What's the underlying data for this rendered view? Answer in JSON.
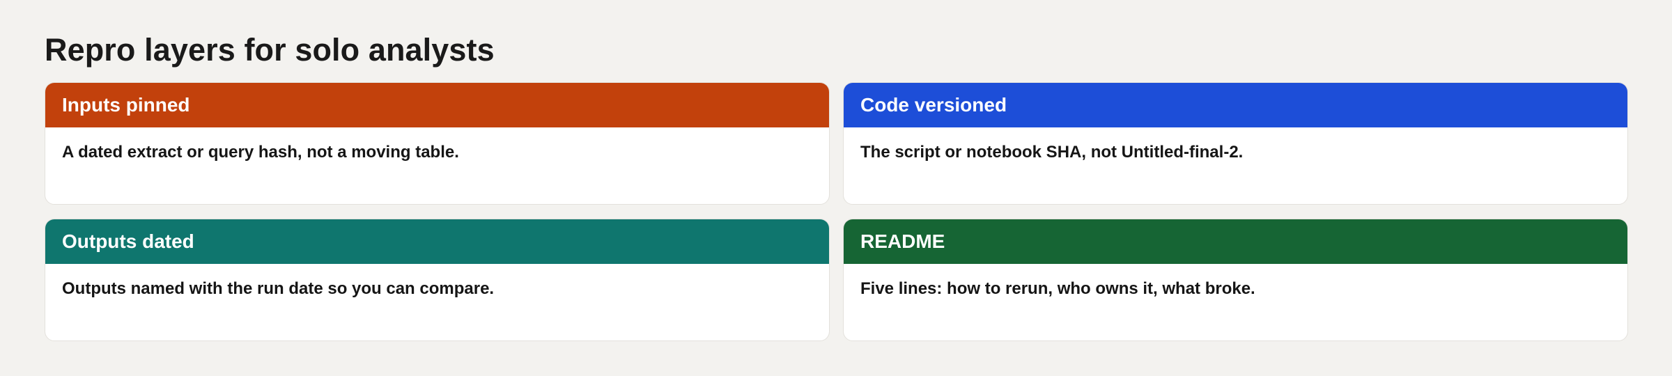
{
  "title": "Repro layers for solo analysts",
  "cards": [
    {
      "heading": "Inputs pinned",
      "body": "A dated extract or query hash, not a moving table.",
      "color": "#c2410c"
    },
    {
      "heading": "Code versioned",
      "body": "The script or notebook SHA, not Untitled-final-2.",
      "color": "#1d4ed8"
    },
    {
      "heading": "Outputs dated",
      "body": "Outputs named with the run date so you can compare.",
      "color": "#0f766e"
    },
    {
      "heading": "README",
      "body": "Five lines: how to rerun, who owns it, what broke.",
      "color": "#166534"
    }
  ]
}
